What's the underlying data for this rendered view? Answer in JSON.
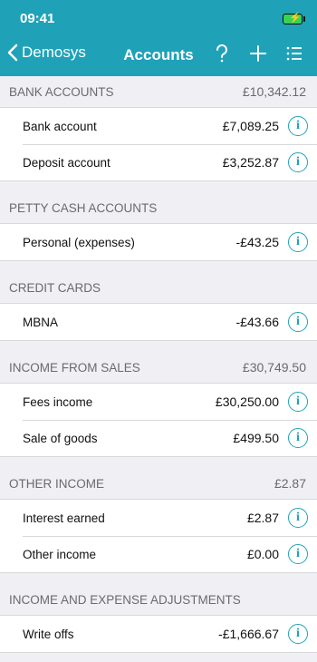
{
  "status": {
    "time": "09:41"
  },
  "nav": {
    "back_label": "Demosys",
    "title": "Accounts"
  },
  "sections": [
    {
      "title": "BANK ACCOUNTS",
      "total": "£10,342.12",
      "rows": [
        {
          "name": "Bank account",
          "amount": "£7,089.25"
        },
        {
          "name": "Deposit account",
          "amount": "£3,252.87"
        }
      ]
    },
    {
      "title": "PETTY CASH ACCOUNTS",
      "total": "",
      "rows": [
        {
          "name": "Personal (expenses)",
          "amount": "-£43.25"
        }
      ]
    },
    {
      "title": "CREDIT CARDS",
      "total": "",
      "rows": [
        {
          "name": "MBNA",
          "amount": "-£43.66"
        }
      ]
    },
    {
      "title": "INCOME FROM SALES",
      "total": "£30,749.50",
      "rows": [
        {
          "name": "Fees income",
          "amount": "£30,250.00"
        },
        {
          "name": "Sale of goods",
          "amount": "£499.50"
        }
      ]
    },
    {
      "title": "OTHER INCOME",
      "total": "£2.87",
      "rows": [
        {
          "name": "Interest earned",
          "amount": "£2.87"
        },
        {
          "name": "Other income",
          "amount": "£0.00"
        }
      ]
    },
    {
      "title": "INCOME AND EXPENSE ADJUSTMENTS",
      "total": "",
      "rows": [
        {
          "name": "Write offs",
          "amount": "-£1,666.67"
        }
      ]
    }
  ],
  "colors": {
    "accent": "#1fa2b8",
    "background": "#efeff4"
  },
  "icons": {
    "back": "chevron-left-icon",
    "help": "question-icon",
    "add": "plus-icon",
    "menu": "list-icon",
    "info": "info-icon"
  }
}
